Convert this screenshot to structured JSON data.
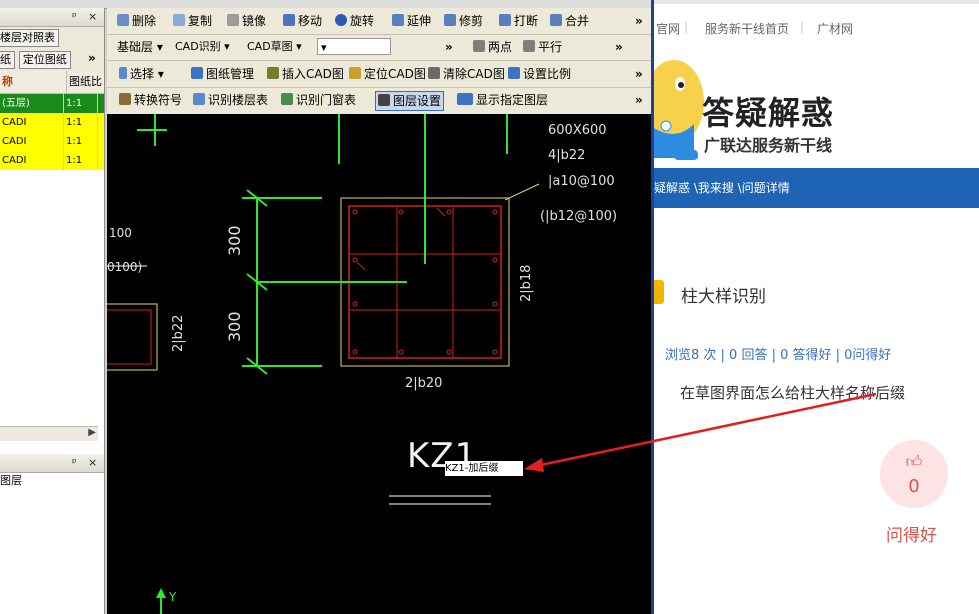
{
  "cad": {
    "left_panel": {
      "title_btn_pin": "ᵖ",
      "title_btn_close": "×",
      "tab_floor_map": "楼层对照表",
      "tab_drawing": "纸",
      "tab_locate": "定位图纸",
      "more": "»",
      "col_name": "称",
      "col_scale": "图纸比",
      "rows": [
        {
          "name": "(五层)",
          "scale": "1:1",
          "bg": "#1a8a1a",
          "fg": "#ffffff"
        },
        {
          "name": "CADI",
          "scale": "1:1",
          "bg": "#ffff00",
          "fg": "#000000"
        },
        {
          "name": "CADI",
          "scale": "1:1",
          "bg": "#ffff00",
          "fg": "#000000"
        },
        {
          "name": "CADI",
          "scale": "1:1",
          "bg": "#ffff00",
          "fg": "#000000"
        }
      ],
      "lower_panel_item": "图层"
    },
    "toolbar1": {
      "delete": "删除",
      "copy": "复制",
      "mirror": "镜像",
      "move": "移动",
      "rotate": "旋转",
      "extend": "延伸",
      "trim": "修剪",
      "break": "打断",
      "merge": "合并",
      "more": "»"
    },
    "toolbar2": {
      "layer": "基础层",
      "cad_recognize": "CAD识别",
      "cad_draft": "CAD草图",
      "two_points": "两点",
      "parallel": "平行",
      "more": "»"
    },
    "toolbar3": {
      "select": "选择",
      "drawing_mgmt": "图纸管理",
      "insert_cad": "插入CAD图",
      "locate_cad": "定位CAD图",
      "clear_cad": "清除CAD图",
      "set_scale": "设置比例",
      "more": "»"
    },
    "toolbar4": {
      "convert_symbol": "转换符号",
      "recognize_floor": "识别楼层表",
      "recognize_door": "识别门窗表",
      "layer_settings": "图层设置",
      "show_layer": "显示指定图层",
      "more": "»"
    },
    "drawing": {
      "dim_600": "600X600",
      "bars_4": "4|b22",
      "stirrup": "|a10@100",
      "stirrup2": "(|b12@100)",
      "left_100": "100",
      "left_0100": "0100)",
      "dim_300_top": "300",
      "dim_300_bottom": "300",
      "side_2b22": "2|b22",
      "side_2b18": "2|b18",
      "bottom_2b20": "2|b20",
      "kz1": "KZ1",
      "kz1_input": "KZ1-加后缀",
      "axis_y": "Y"
    }
  },
  "web": {
    "nav": [
      "官网",
      "服务新干线首页",
      "广材网"
    ],
    "logo_title": "答疑解惑",
    "logo_sub": "广联达服务新干线",
    "breadcrumb": "疑解惑 \\我来搜 \\问题详情",
    "question_title": "柱大样识别",
    "stats": "浏览8 次 | 0 回答 | 0 答得好 | 0问得好",
    "question_body": "在草图界面怎么给柱大样名称后缀",
    "like_count": "0",
    "like_label": "问得好",
    "accent": "#1f63b5"
  }
}
